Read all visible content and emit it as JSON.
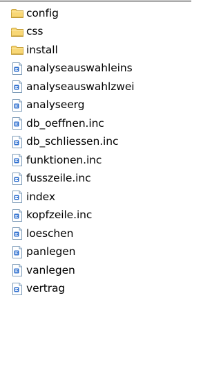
{
  "window": {
    "title": ""
  },
  "items": [
    {
      "name": "config",
      "type": "folder"
    },
    {
      "name": "css",
      "type": "folder"
    },
    {
      "name": "install",
      "type": "folder"
    },
    {
      "name": "analyseauswahleins",
      "type": "file"
    },
    {
      "name": "analyseauswahlzwei",
      "type": "file"
    },
    {
      "name": "analyseerg",
      "type": "file"
    },
    {
      "name": "db_oeffnen.inc",
      "type": "file"
    },
    {
      "name": "db_schliessen.inc",
      "type": "file"
    },
    {
      "name": "funktionen.inc",
      "type": "file"
    },
    {
      "name": "fusszeile.inc",
      "type": "file"
    },
    {
      "name": "index",
      "type": "file"
    },
    {
      "name": "kopfzeile.inc",
      "type": "file"
    },
    {
      "name": "loeschen",
      "type": "file"
    },
    {
      "name": "panlegen",
      "type": "file"
    },
    {
      "name": "vanlegen",
      "type": "file"
    },
    {
      "name": "vertrag",
      "type": "file"
    }
  ],
  "icons": {
    "folder": "folder-icon",
    "file": "php-file-icon"
  },
  "colors": {
    "folder_fill": "#F8D776",
    "folder_edge": "#C8A23A",
    "file_paper": "#FFFFFF",
    "file_border": "#7F9DB9",
    "file_accent": "#2E6FCF"
  }
}
